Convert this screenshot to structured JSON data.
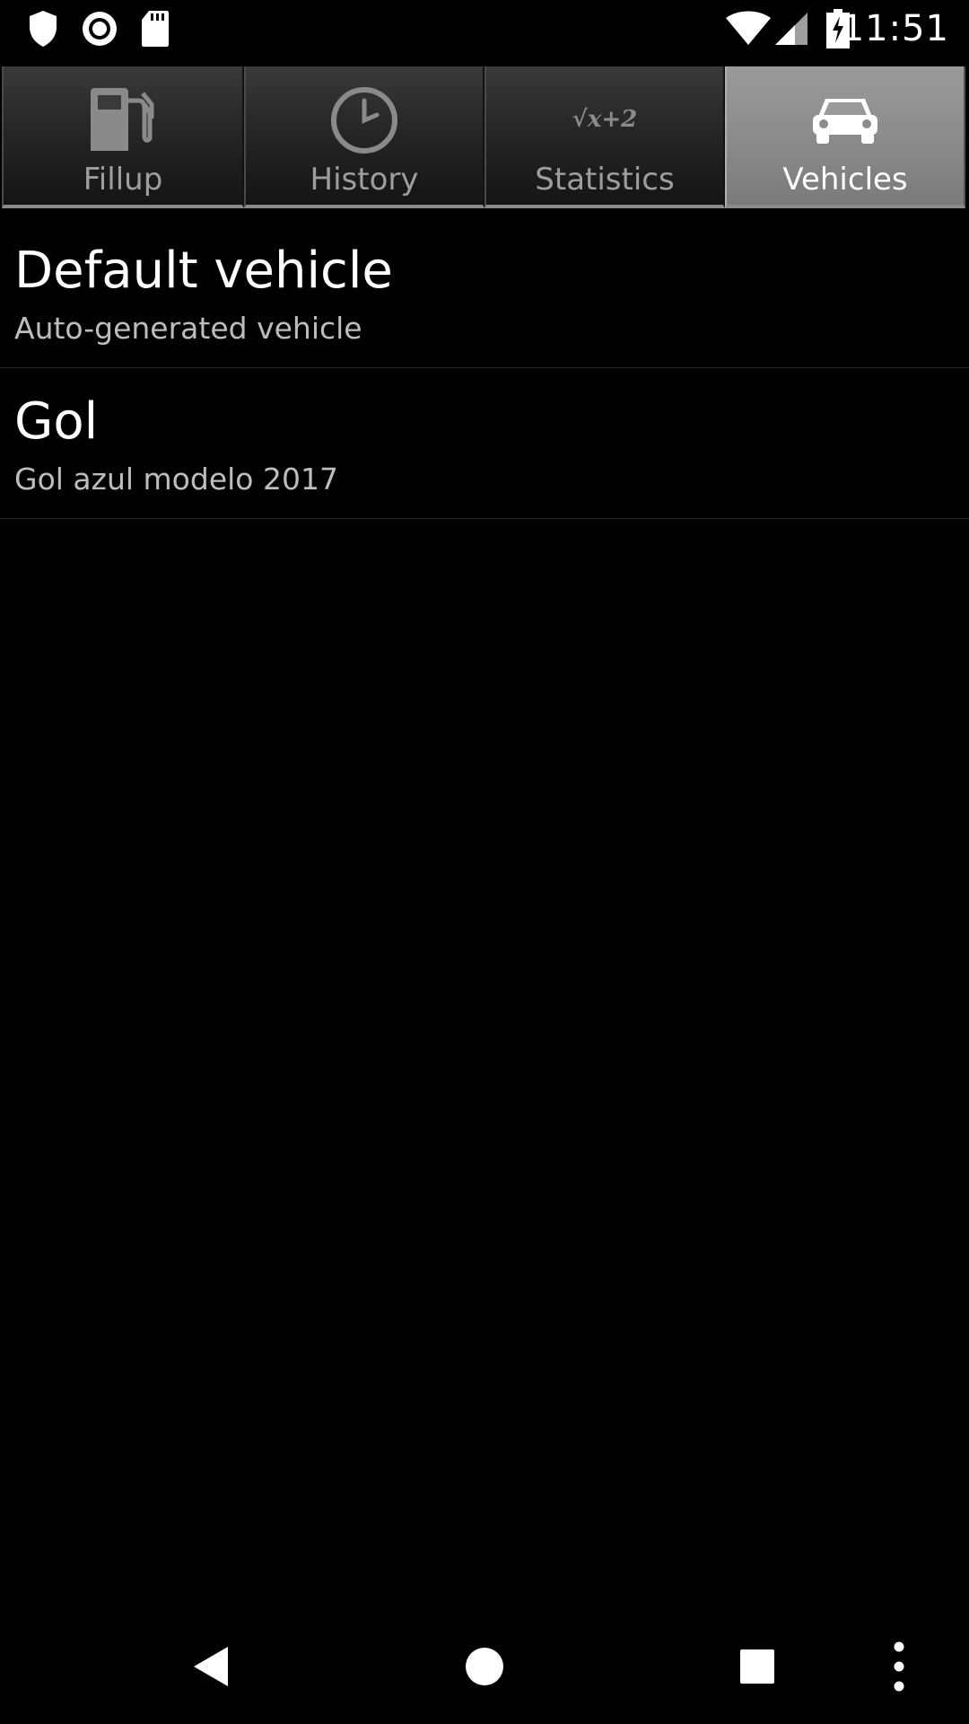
{
  "status_bar": {
    "time": "11:51",
    "left_icons": [
      "shield-icon",
      "record-icon",
      "sd-card-icon"
    ],
    "right_icons": [
      "wifi-icon",
      "cell-signal-icon",
      "battery-charging-icon"
    ]
  },
  "tabs": [
    {
      "label": "Fillup",
      "icon": "fuel-pump-icon",
      "selected": false
    },
    {
      "label": "History",
      "icon": "clock-icon",
      "selected": false
    },
    {
      "label": "Statistics",
      "icon": "formula-icon",
      "selected": false
    },
    {
      "label": "Vehicles",
      "icon": "car-icon",
      "selected": true
    }
  ],
  "statistics_icon_text": "√x+2",
  "vehicles": [
    {
      "name": "Default vehicle",
      "description": "Auto-generated vehicle"
    },
    {
      "name": "Gol",
      "description": "Gol azul modelo 2017"
    }
  ],
  "nav_bar": [
    "back-icon",
    "home-icon",
    "recents-icon",
    "overflow-menu-icon"
  ],
  "colors": {
    "background": "#000000",
    "tab_unselected_text": "#9e9e9e",
    "tab_selected_bg": "#8c8c8c",
    "primary_text": "#ffffff",
    "secondary_text": "#bdbdbd"
  }
}
